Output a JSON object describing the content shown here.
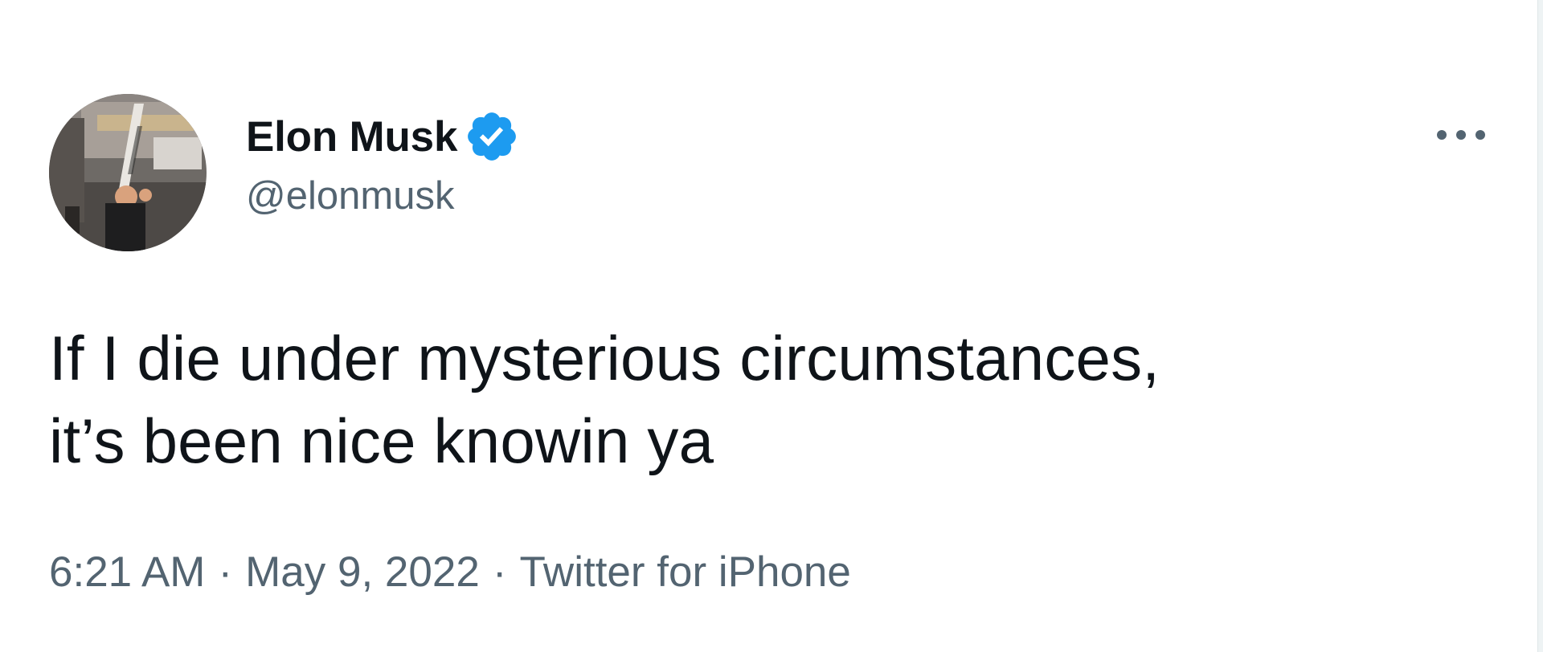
{
  "author": {
    "display_name": "Elon Musk",
    "handle": "@elonmusk",
    "verified_icon": "verified-badge-icon",
    "avatar_icon": "profile-photo"
  },
  "menu": {
    "more_icon": "more-options-icon"
  },
  "tweet": {
    "text": "If I die under mysterious circumstances,\nit’s been nice knowin ya",
    "time": "6:21 AM",
    "date": "May 9, 2022",
    "source": "Twitter for iPhone",
    "separator": "·"
  },
  "colors": {
    "primary_text": "#0f1419",
    "secondary_text": "#536471",
    "verified_blue": "#1d9bf0",
    "background": "#ffffff"
  }
}
